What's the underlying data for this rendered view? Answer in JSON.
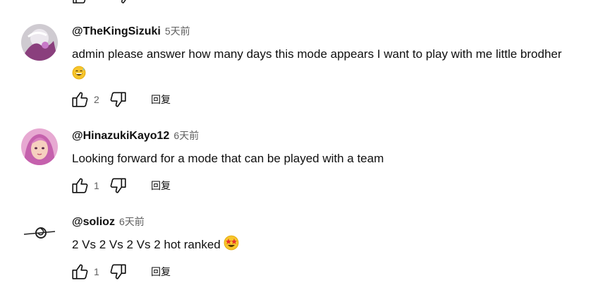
{
  "comments": [
    {
      "author": "@TheKingSizuki",
      "time": "5天前",
      "text": "admin please answer how many days this mode appears I want to play with me little brodher",
      "emoji": "grinning-sweat-emoji",
      "likes": "2",
      "reply_label": "回复",
      "avatar_colors": [
        "#d9d5da",
        "#7b2f6b"
      ]
    },
    {
      "author": "@HinazukiKayo12",
      "time": "6天前",
      "text": "Looking forward for a mode that can be played with a team",
      "likes": "1",
      "reply_label": "回复",
      "avatar_colors": [
        "#f2b6d6",
        "#b34a9a"
      ]
    },
    {
      "author": "@solioz",
      "time": "6天前",
      "text": "2 Vs 2 Vs 2 Vs 2 hot ranked",
      "emoji": "star-struck-emoji",
      "likes": "1",
      "reply_label": "回复",
      "avatar_colors": [
        "#ffffff",
        "#222222"
      ]
    }
  ],
  "icons": {
    "like": "thumb-up-icon",
    "dislike": "thumb-down-icon"
  },
  "colors": {
    "text_primary": "#0f0f0f",
    "text_secondary": "#606060"
  }
}
